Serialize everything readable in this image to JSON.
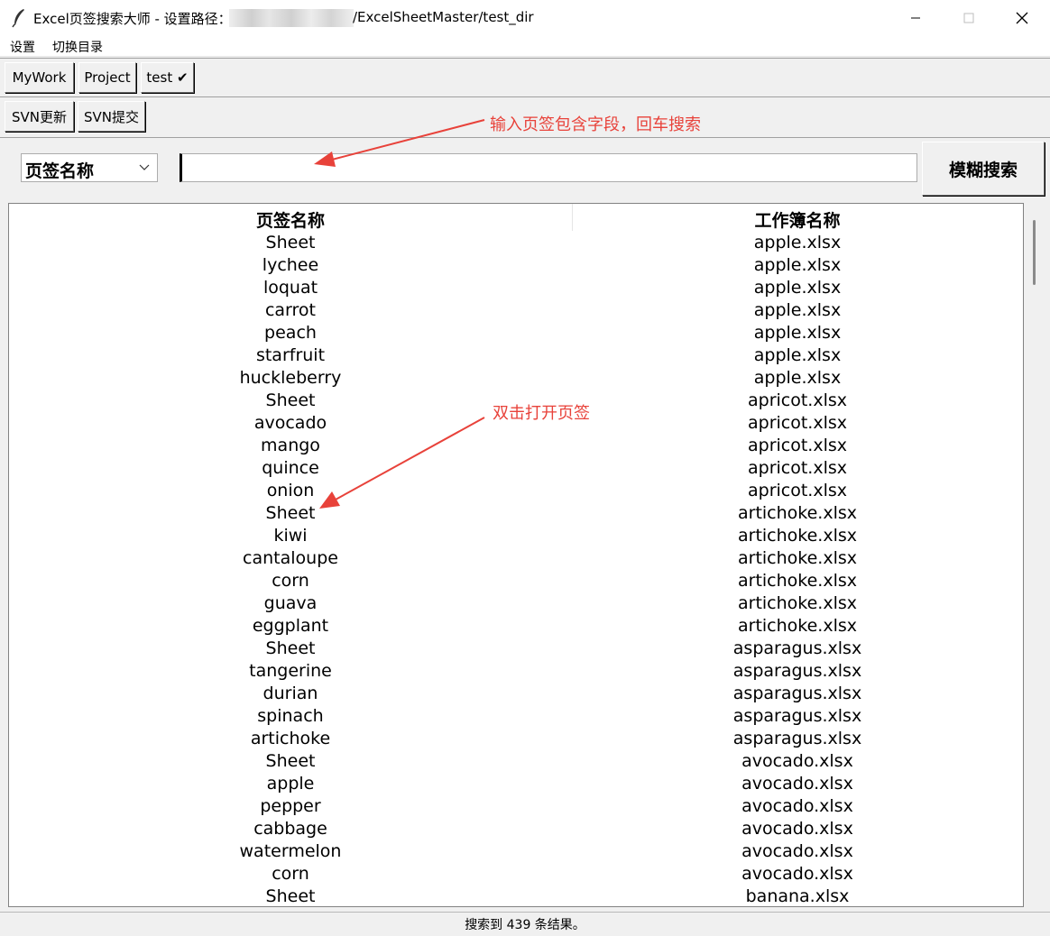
{
  "window": {
    "title_prefix": "Excel页签搜索大师 - 设置路径：",
    "title_path": "/ExcelSheetMaster/test_dir"
  },
  "menu": [
    "设置",
    "切换目录"
  ],
  "workspaces": [
    "MyWork",
    "Project",
    "test ✔"
  ],
  "svn": [
    "SVN更新",
    "SVN提交"
  ],
  "annotations": {
    "search_hint": "输入页签包含字段，回车搜索",
    "open_hint": "双击打开页签",
    "color": "#e8423a"
  },
  "search": {
    "field_select": "页签名称",
    "query": "",
    "button": "模糊搜索"
  },
  "table": {
    "columns": [
      "页签名称",
      "工作簿名称"
    ],
    "rows": [
      [
        "Sheet",
        "apple.xlsx"
      ],
      [
        "lychee",
        "apple.xlsx"
      ],
      [
        "loquat",
        "apple.xlsx"
      ],
      [
        "carrot",
        "apple.xlsx"
      ],
      [
        "peach",
        "apple.xlsx"
      ],
      [
        "starfruit",
        "apple.xlsx"
      ],
      [
        "huckleberry",
        "apple.xlsx"
      ],
      [
        "Sheet",
        "apricot.xlsx"
      ],
      [
        "avocado",
        "apricot.xlsx"
      ],
      [
        "mango",
        "apricot.xlsx"
      ],
      [
        "quince",
        "apricot.xlsx"
      ],
      [
        "onion",
        "apricot.xlsx"
      ],
      [
        "Sheet",
        "artichoke.xlsx"
      ],
      [
        "kiwi",
        "artichoke.xlsx"
      ],
      [
        "cantaloupe",
        "artichoke.xlsx"
      ],
      [
        "corn",
        "artichoke.xlsx"
      ],
      [
        "guava",
        "artichoke.xlsx"
      ],
      [
        "eggplant",
        "artichoke.xlsx"
      ],
      [
        "Sheet",
        "asparagus.xlsx"
      ],
      [
        "tangerine",
        "asparagus.xlsx"
      ],
      [
        "durian",
        "asparagus.xlsx"
      ],
      [
        "spinach",
        "asparagus.xlsx"
      ],
      [
        "artichoke",
        "asparagus.xlsx"
      ],
      [
        "Sheet",
        "avocado.xlsx"
      ],
      [
        "apple",
        "avocado.xlsx"
      ],
      [
        "pepper",
        "avocado.xlsx"
      ],
      [
        "cabbage",
        "avocado.xlsx"
      ],
      [
        "watermelon",
        "avocado.xlsx"
      ],
      [
        "corn",
        "avocado.xlsx"
      ],
      [
        "Sheet",
        "banana.xlsx"
      ]
    ]
  },
  "status": "搜索到 439 条结果。"
}
